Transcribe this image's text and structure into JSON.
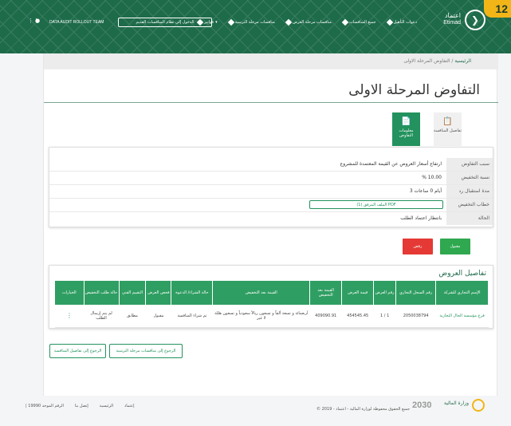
{
  "header": {
    "corner_badge": "12",
    "logo_ar": "اعتماد",
    "logo_en": "Etimad",
    "nav": [
      "دعوات التأهيل",
      "جميع المنافسات",
      "منافسات مرحلة العرض",
      "منافسات مرحلة الترسية",
      "فواتير"
    ],
    "old_system_button": "الدخول إلى نظام المنافسات القديم",
    "team_name": "DATA AUDIT ROLLOUT TEAM"
  },
  "breadcrumb": {
    "home": "الرئيسية",
    "sep": "/",
    "current": "التفاوض المرحلة الاولى"
  },
  "page_title": "التفاوض المرحلة الاولى",
  "tabs": [
    {
      "label": "تفاصيل المنافسة",
      "icon": "clipboard-icon"
    },
    {
      "label": "معلومات التفاوض",
      "icon": "document-icon"
    }
  ],
  "info": [
    {
      "label": "سبب التفاوض",
      "value": "ارتفاع أسعار العروض عن القيمة المعتمدة للمشروع"
    },
    {
      "label": "نسبة التخفيض",
      "value": "%  10.00"
    },
    {
      "label": "مدة استقبال رد المورد",
      "value": "3 أيام 0 ساعات"
    },
    {
      "label": "خطاب التخفيض",
      "value": "الملف المرفق (1) PDF"
    },
    {
      "label": "الحالة",
      "value": "بانتظار اعتماد الطلب"
    }
  ],
  "actions": {
    "accept": "مقبول",
    "reject": "رفض"
  },
  "offers": {
    "title": "تفاصيل العروض",
    "columns": [
      "الإسم التجاري للشركة",
      "رقم السجل التجاري",
      "رقم العرض",
      "قيمة العرض",
      "القيمة بعد التخفيض",
      "القيمة بعد التخفيض",
      "حالة الشراء/ الدعوة",
      "فحص العرض",
      "التقييم الفني",
      "حالة طلب التخفيض",
      "الخيارات"
    ],
    "rows": [
      [
        "فرع مؤسسة الحال التجارية",
        "2050038794",
        "1 / 1",
        "454545.45",
        "409090.91",
        "أربعمائة و تسعة ألفاً و تسعون ريالاً سعودياً و تسعون هللة لا غير",
        "تم شراء المنافسة",
        "مقبول",
        "مطابق",
        "لم يتم إرسال الطلب",
        "⋮"
      ]
    ]
  },
  "bottom_buttons": {
    "back_details": "الرجوع إلى تفاصيل المنافسة",
    "back_awarding": "الرجوع إلى منافسات مرحلة الترسية"
  },
  "footer": {
    "copyright": "© جميع الحقوق محفوظة لوزارة المالية - اعتماد - 2019",
    "links": [
      "إعتماد",
      "الرئيسية",
      "إتصل بنا",
      "| الرقم الموحد  19990"
    ],
    "vision": "2030",
    "ministry": "وزارة المالية"
  }
}
